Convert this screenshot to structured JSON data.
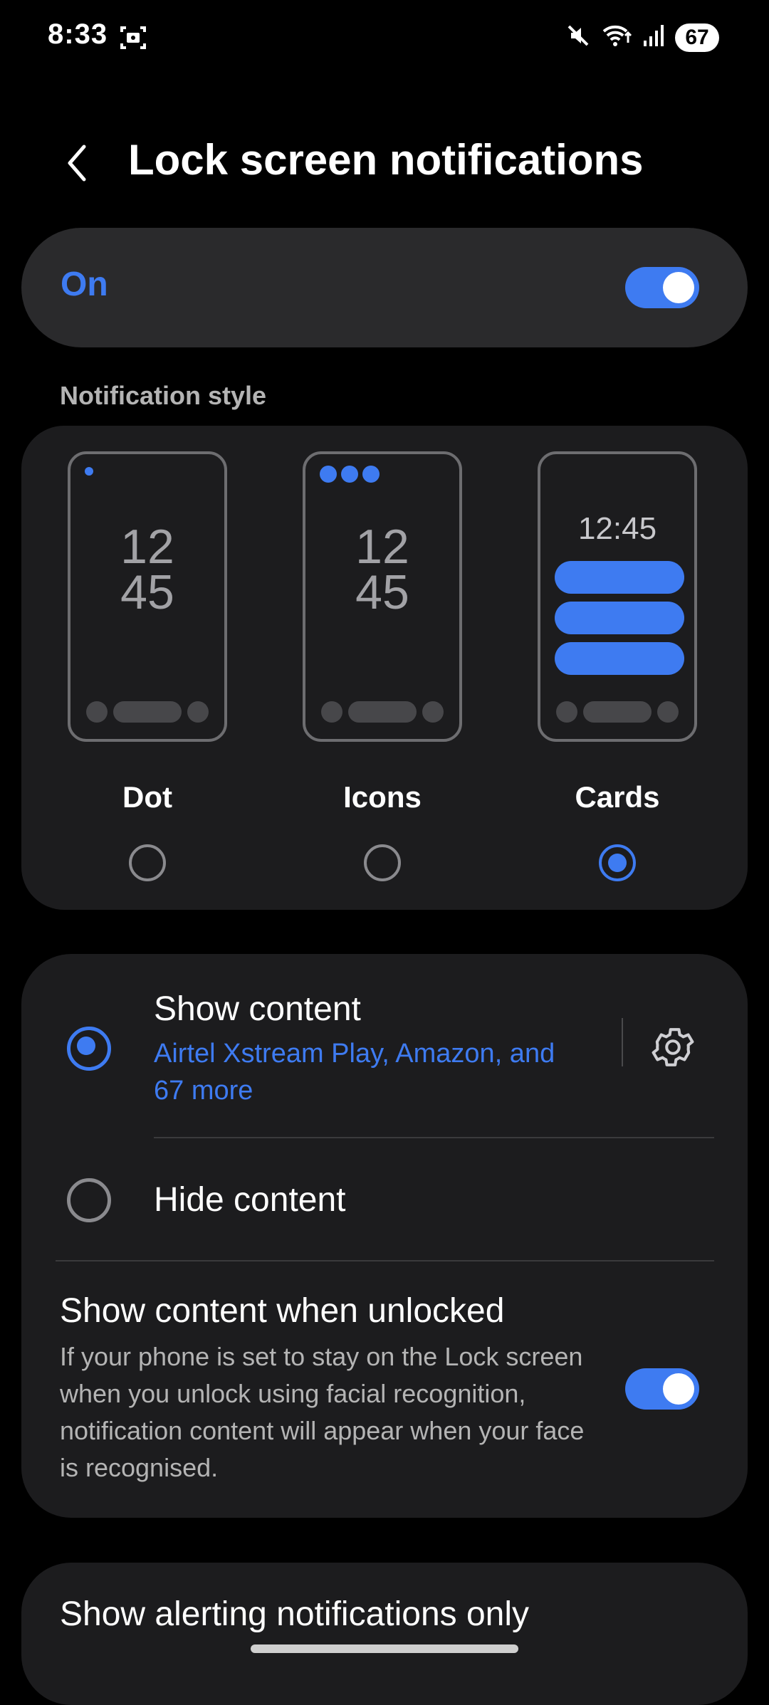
{
  "status_bar": {
    "time": "8:33",
    "battery": "67",
    "icons": [
      "screenshot-icon",
      "mute-icon",
      "wifi-icon",
      "signal-icon",
      "battery-icon"
    ]
  },
  "header": {
    "title": "Lock screen notifications",
    "back_icon": "chevron-left-icon"
  },
  "master_toggle": {
    "label": "On",
    "checked": true
  },
  "notification_style": {
    "section_label": "Notification style",
    "options": [
      {
        "label": "Dot",
        "clock_hour": "12",
        "clock_min": "45",
        "selected": false
      },
      {
        "label": "Icons",
        "clock_hour": "12",
        "clock_min": "45",
        "selected": false
      },
      {
        "label": "Cards",
        "clock": "12:45",
        "selected": true
      }
    ]
  },
  "content": {
    "show_content": {
      "title": "Show content",
      "subtitle": "Airtel Xstream Play, Amazon, and 67 more",
      "selected": true,
      "settings_icon": "gear-icon"
    },
    "hide_content": {
      "title": "Hide content",
      "selected": false
    },
    "show_when_unlocked": {
      "title": "Show content when unlocked",
      "description": "If your phone is set to stay on the Lock screen when you unlock using facial recognition, notification content will appear when your face is recognised.",
      "checked": true
    }
  },
  "alerting_only": {
    "title": "Show alerting notifications only"
  },
  "colors": {
    "accent": "#3e7bf1",
    "card_bg": "#1c1c1e",
    "master_bg": "#2a2a2c"
  }
}
